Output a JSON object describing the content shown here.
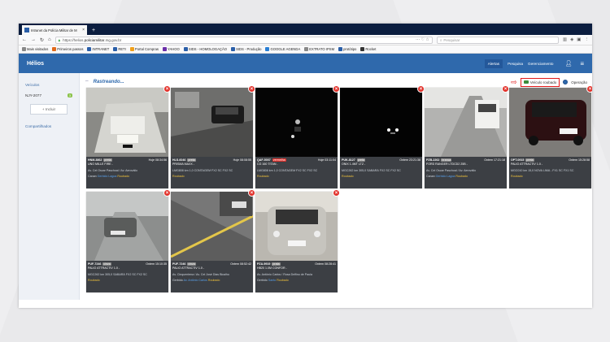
{
  "browser": {
    "tab_title": "Intranet da Polícia Militar de M",
    "tab_close": "×",
    "new_tab": "+",
    "url_prefix": "https://helios.",
    "url_domain": "policiamilitar",
    "url_suffix": ".mg.gov.br",
    "url_menu": "··· ♡ ☆",
    "search_placeholder": "Pesquisar",
    "bookmarks": [
      {
        "label": "Mais visitados",
        "color": "#888888"
      },
      {
        "label": "Primeiros passos",
        "color": "#e06a1a"
      },
      {
        "label": "INTRANET",
        "color": "#2a5ea8"
      },
      {
        "label": "REТI",
        "color": "#2a5ea8"
      },
      {
        "label": "Portal Compras",
        "color": "#f0a01a"
      },
      {
        "label": "YAHOO",
        "color": "#6a2ea8"
      },
      {
        "label": "SIDS - HOMOLOGAÇÃO",
        "color": "#2a5ea8"
      },
      {
        "label": "SIDS - Produção",
        "color": "#2a5ea8"
      },
      {
        "label": "GOOGLE AGENDA",
        "color": "#2a7fd4"
      },
      {
        "label": "EXTRATO IPSM",
        "color": "#888888"
      },
      {
        "label": "protótipo",
        "color": "#2a5ea8"
      },
      {
        "label": "Rocket",
        "color": "#333333"
      }
    ]
  },
  "app": {
    "brand": "Hélios",
    "menu": {
      "alertas": "Alertas",
      "pesquisa": "Pesquisa",
      "gerenciamento": "Gerenciamento"
    }
  },
  "sidebar": {
    "veiculos": "Veículos",
    "item_label": "NJY-2077",
    "item_badge": "3",
    "incluir": "+ Incluir",
    "compartilhados": "Compartilhados"
  },
  "main": {
    "title": "Rastreando...",
    "veiculo_roubado": "Veículo roubado",
    "operacao": "Operação"
  },
  "cards": [
    {
      "plate": "HNM-3862",
      "tag": "preta",
      "tag_color": "grey",
      "time": "Hoje 08:34:56",
      "model": "UNO MILLE FIRE -",
      "loc1": "Av. Cel Oscar Paschoal / Av. Aeroválio",
      "loc2_a": "Canan",
      "loc2_b": "Gerbido Lagoa",
      "loc2_c": "Roubado"
    },
    {
      "plate": "HLS-6046",
      "tag": "preta",
      "tag_color": "grey",
      "time": "Hoje 08:08:55",
      "model": "PRISMA MAXX -",
      "loc1": "LMG808 km 1,0 CONTAGEM FX2 SC FX2 SC",
      "loc2_a": "",
      "loc2_b": "",
      "loc2_c": "Roubado"
    },
    {
      "plate": "QAF-5007",
      "tag": "vermelha",
      "tag_color": "red",
      "time": "Hoje 03:11:04",
      "model": "CG 160 TITAN -",
      "loc1": "LMG808 km 1,0 CONTAGEM FX2 SC FX2 SC",
      "loc2_a": "",
      "loc2_b": "",
      "loc2_c": "Roubado"
    },
    {
      "plate": "PUK-8127",
      "tag": "preta",
      "tag_color": "grey",
      "time": "Ontem 23:21:38",
      "model": "ONIX 1.4MT LTZ -",
      "loc1": "MGC262 km 305,0 SABARÁ FX2 SC FX2 SC",
      "loc2_a": "",
      "loc2_b": "",
      "loc2_c": "Roubado"
    },
    {
      "plate": "PZB-2262",
      "tag": "branca",
      "tag_color": "grey",
      "time": "Ontem 17:21:18",
      "model": "FORD RANGER LTDCD2 25B -",
      "loc1": "Av. Cel Oscar Paschoal / Av. Aeroválio",
      "loc2_a": "Canan",
      "loc2_b": "Gerbido Lagoa",
      "loc2_c": "Roubado"
    },
    {
      "plate": "OPT-0915",
      "tag": "preta",
      "tag_color": "grey",
      "time": "Ontem 15:28:58",
      "model": "PALIO ATTRACTIV 1.0 -",
      "loc1": "MGC010 km 15,0 NOVA LIMA - FX1 SC FX1 SC",
      "loc2_a": "",
      "loc2_b": "",
      "loc2_c": "Roubado"
    },
    {
      "plate": "PUF-7246",
      "tag": "cinza",
      "tag_color": "grey",
      "time": "Ontem 15:10:35",
      "model": "PALIO ATTRACTIV 1.0 -",
      "loc1": "MGC262 km 305,0 SABARÁ FX2 SC FX2 SC",
      "loc2_a": "",
      "loc2_b": "",
      "loc2_c": "Roubado"
    },
    {
      "plate": "PUF-7246",
      "tag": "cinza",
      "tag_color": "grey",
      "time": "Ontem 08:52:42",
      "model": "PALIO ATTRACTIV 1.0 -",
      "loc1": "Av. Cinquentena / Av. Cel José Dias Bicalho",
      "loc2_a": "Gerbido",
      "loc2_b": "Av. Antônio Carlos",
      "loc2_c": "Roubado"
    },
    {
      "plate": "PZA-9919",
      "tag": "prata",
      "tag_color": "grey",
      "time": "Ontem 08:28:41",
      "model": "HB20 1.0M CONFOR -",
      "loc1": "Av. Antônio Carlos / Rosa Delfino de Paula",
      "loc2_a": "Gerbido",
      "loc2_b": "Santo",
      "loc2_c": "Roubado"
    }
  ]
}
